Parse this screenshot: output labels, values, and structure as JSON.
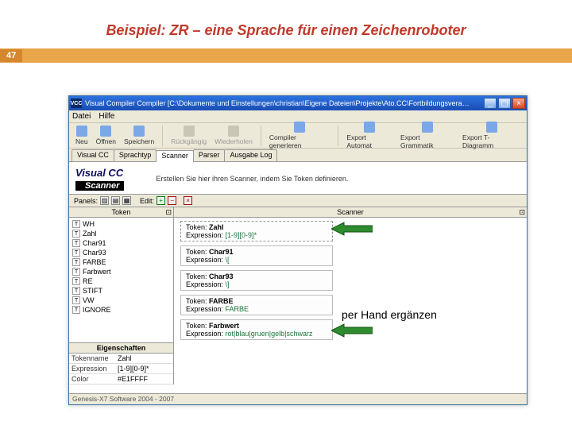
{
  "slide": {
    "title": "Beispiel:  ZR – eine Sprache für einen Zeichenroboter",
    "number": "47",
    "annotation": "per Hand ergänzen"
  },
  "window": {
    "title_prefix": "Visual Compiler Compiler [C:\\Dokumente und Einstellungen\\christian\\Eigene Dateien\\Projekte\\Ato.CC\\Fortbildungsvera…",
    "icon_text": "VCC"
  },
  "menu": {
    "items": [
      "Datei",
      "Hilfe"
    ]
  },
  "toolbar": {
    "neu": "Neu",
    "oeffnen": "Öffnen",
    "speichern": "Speichern",
    "rueck": "Rückgängig",
    "wieder": "Wiederholen",
    "compgen": "Compiler generieren",
    "exp_automat": "Export Automat",
    "exp_grammatik": "Export Grammatik",
    "exp_tdiag": "Export T-Diagramm"
  },
  "tabs": {
    "items": [
      "Visual CC",
      "Sprachtyp",
      "Scanner",
      "Parser",
      "Ausgabe Log"
    ],
    "active_index": 2
  },
  "logo": {
    "line1": "Visual CC",
    "line2": "Scanner",
    "desc": "Erstellen Sie hier ihren Scanner, indem Sie Token definieren."
  },
  "panelsbar": {
    "label": "Panels:",
    "edit_label": "Edit:"
  },
  "left": {
    "token_header": "Token",
    "tokens": [
      "WH",
      "Zahl",
      "Char91",
      "Char93",
      "FARBE",
      "Farbwert",
      "RE",
      "STIFT",
      "VW",
      "IGNORE"
    ],
    "props_header": "Eigenschaften",
    "props": {
      "Tokenname": {
        "k": "Tokenname",
        "v": "Zahl"
      },
      "Expression": {
        "k": "Expression",
        "v": "[1-9][0-9]*"
      },
      "Color": {
        "k": "Color",
        "v": "#E1FFFF"
      }
    }
  },
  "right": {
    "header": "Scanner",
    "token_label": "Token:",
    "expr_label": "Expression:",
    "boxes": [
      {
        "name": "Zahl",
        "expr": "[1-9][0-9]*",
        "dashed": true
      },
      {
        "name": "Char91",
        "expr": "\\[",
        "dashed": false
      },
      {
        "name": "Char93",
        "expr": "\\]",
        "dashed": false
      },
      {
        "name": "FARBE",
        "expr": "FARBE",
        "dashed": false
      },
      {
        "name": "Farbwert",
        "expr": "rot|blau|gruen|gelb|schwarz",
        "dashed": false
      }
    ]
  },
  "status": {
    "text": "Genesis-X7 Software 2004 - 2007"
  }
}
